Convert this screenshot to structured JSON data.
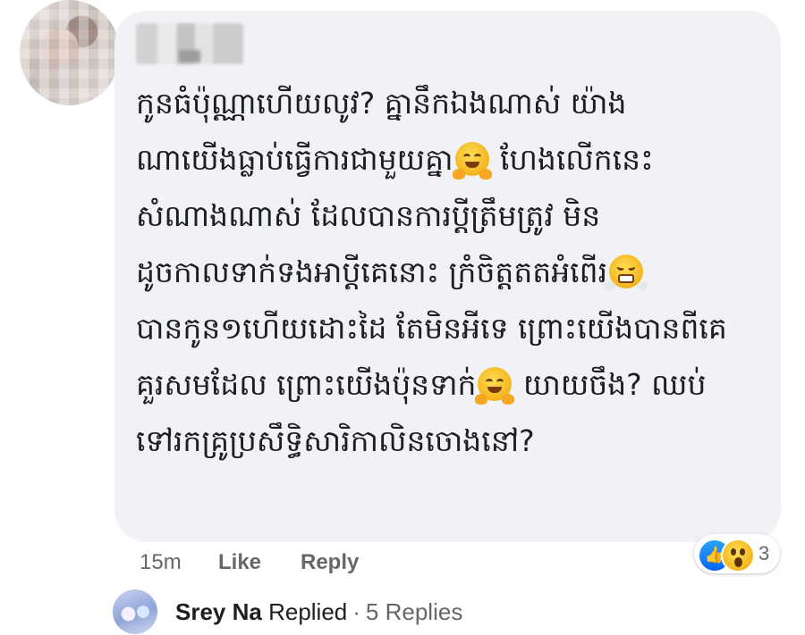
{
  "comment": {
    "author_name_blurred": "",
    "lines": [
      {
        "text": "កូនធំប៉ុណ្ណាហើយលូវ? គ្នានឹកឯងណាស់  យ៉ាង",
        "emoji_after": null
      },
      {
        "text": "ណាយើងធ្លាប់ធ្វើការជាមួយគ្នា",
        "emoji_after": "hugging-face",
        "tail": "  ហែងលើកនេះ"
      },
      {
        "text": "សំណាងណាស់  ដែលបានការប្ដីត្រឹមត្រូវ  មិន",
        "emoji_after": null
      },
      {
        "text": "ដូចកាលទាក់ទងអាប្ដីគេនោះ  ក្រំចិត្តតតអំពើរ",
        "emoji_after": "face-with-steam",
        "tail": ""
      },
      {
        "text": "បានកូន១ហើយដោះដៃ  តែមិនអីទេ  ព្រោះយើងបានពីគេ",
        "emoji_after": null
      },
      {
        "text": "គួរសមដែល  ព្រោះយើងប៉ុនទាក់",
        "emoji_after": "hugging-face",
        "tail": "  យាយចឹង? ឈប់"
      },
      {
        "text": "ទៅរកគ្រូប្រសឹទ្ធិសារិកាលិនចោងនៅ?",
        "emoji_after": null
      }
    ]
  },
  "actions": {
    "time": "15m",
    "like_label": "Like",
    "reply_label": "Reply"
  },
  "reactions": {
    "icons": [
      "like-icon",
      "wow-icon"
    ],
    "count": "3"
  },
  "reply_summary": {
    "name": "Srey Na",
    "verb": "Replied",
    "separator": "·",
    "count_label": "5 Replies"
  },
  "colors": {
    "bubble": "#f0f2f5",
    "secondary_text": "#65676b",
    "like_blue": "#0866ff"
  }
}
